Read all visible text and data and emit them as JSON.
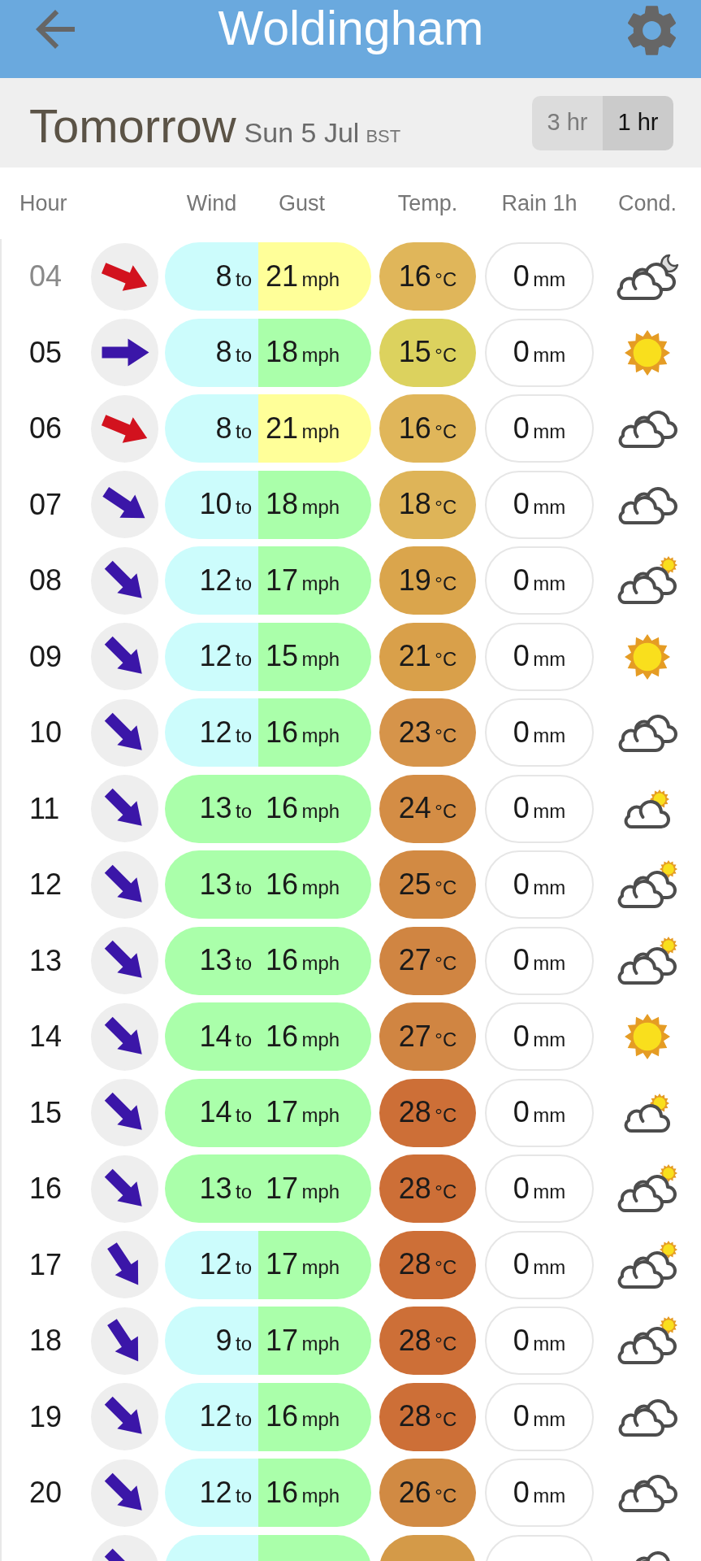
{
  "header": {
    "title": "Woldingham"
  },
  "day": {
    "title": "Tomorrow",
    "date": "Sun 5 Jul",
    "zone": "BST"
  },
  "interval": [
    {
      "label": "3 hr",
      "selected": false
    },
    {
      "label": "1 hr",
      "selected": true
    }
  ],
  "columns": [
    "Hour",
    "Wind",
    "Gust",
    "Temp.",
    "Rain 1h",
    "Cond."
  ],
  "rows": [
    {
      "hour": "04",
      "dimmed": true,
      "arrow": {
        "kind": "WNW",
        "color": "#d2121e"
      },
      "wind": {
        "speed": "8",
        "joiner": "to",
        "color": "#ccfcfc"
      },
      "gust": {
        "speed": "21",
        "unit": "mph",
        "color": "#ffff99"
      },
      "temp": {
        "value": "16",
        "unit": "°C",
        "color": "#e0b65a"
      },
      "rain": {
        "value": "0",
        "unit": "mm"
      },
      "condition": {
        "kind": "moon"
      }
    },
    {
      "hour": "05",
      "dimmed": false,
      "arrow": {
        "kind": "W",
        "color": "#3b16a8"
      },
      "wind": {
        "speed": "8",
        "joiner": "to",
        "color": "#ccfcfc"
      },
      "gust": {
        "speed": "18",
        "unit": "mph",
        "color": "#aaffaa"
      },
      "temp": {
        "value": "15",
        "unit": "°C",
        "color": "#dcd25e"
      },
      "rain": {
        "value": "0",
        "unit": "mm"
      },
      "condition": {
        "kind": "sun"
      }
    },
    {
      "hour": "06",
      "dimmed": false,
      "arrow": {
        "kind": "WNW",
        "color": "#d2121e"
      },
      "wind": {
        "speed": "8",
        "joiner": "to",
        "color": "#ccfcfc"
      },
      "gust": {
        "speed": "21",
        "unit": "mph",
        "color": "#ffff99"
      },
      "temp": {
        "value": "16",
        "unit": "°C",
        "color": "#e0b65a"
      },
      "rain": {
        "value": "0",
        "unit": "mm"
      },
      "condition": {
        "kind": "clouds"
      }
    },
    {
      "hour": "07",
      "dimmed": false,
      "arrow": {
        "kind": "NWbW",
        "color": "#3b16a8"
      },
      "wind": {
        "speed": "10",
        "joiner": "to",
        "color": "#ccfcfc"
      },
      "gust": {
        "speed": "18",
        "unit": "mph",
        "color": "#aaffaa"
      },
      "temp": {
        "value": "18",
        "unit": "°C",
        "color": "#deb458"
      },
      "rain": {
        "value": "0",
        "unit": "mm"
      },
      "condition": {
        "kind": "clouds"
      }
    },
    {
      "hour": "08",
      "dimmed": false,
      "arrow": {
        "kind": "NW",
        "color": "#3b16a8"
      },
      "wind": {
        "speed": "12",
        "joiner": "to",
        "color": "#ccfcfc"
      },
      "gust": {
        "speed": "17",
        "unit": "mph",
        "color": "#aaffaa"
      },
      "temp": {
        "value": "19",
        "unit": "°C",
        "color": "#daa54c"
      },
      "rain": {
        "value": "0",
        "unit": "mm"
      },
      "condition": {
        "kind": "sunclouds"
      }
    },
    {
      "hour": "09",
      "dimmed": false,
      "arrow": {
        "kind": "NW",
        "color": "#3b16a8"
      },
      "wind": {
        "speed": "12",
        "joiner": "to",
        "color": "#ccfcfc"
      },
      "gust": {
        "speed": "15",
        "unit": "mph",
        "color": "#aaffaa"
      },
      "temp": {
        "value": "21",
        "unit": "°C",
        "color": "#d9a04a"
      },
      "rain": {
        "value": "0",
        "unit": "mm"
      },
      "condition": {
        "kind": "sun"
      }
    },
    {
      "hour": "10",
      "dimmed": false,
      "arrow": {
        "kind": "NW",
        "color": "#3b16a8"
      },
      "wind": {
        "speed": "12",
        "joiner": "to",
        "color": "#ccfcfc"
      },
      "gust": {
        "speed": "16",
        "unit": "mph",
        "color": "#aaffaa"
      },
      "temp": {
        "value": "23",
        "unit": "°C",
        "color": "#d6944a"
      },
      "rain": {
        "value": "0",
        "unit": "mm"
      },
      "condition": {
        "kind": "clouds"
      }
    },
    {
      "hour": "11",
      "dimmed": false,
      "arrow": {
        "kind": "NW",
        "color": "#3b16a8"
      },
      "wind": {
        "speed": "13",
        "joiner": "to",
        "color": "#aaffaa"
      },
      "gust": {
        "speed": "16",
        "unit": "mph",
        "color": "#aaffaa"
      },
      "temp": {
        "value": "24",
        "unit": "°C",
        "color": "#d48d45"
      },
      "rain": {
        "value": "0",
        "unit": "mm"
      },
      "condition": {
        "kind": "suncloud"
      }
    },
    {
      "hour": "12",
      "dimmed": false,
      "arrow": {
        "kind": "NW",
        "color": "#3b16a8"
      },
      "wind": {
        "speed": "13",
        "joiner": "to",
        "color": "#aaffaa"
      },
      "gust": {
        "speed": "16",
        "unit": "mph",
        "color": "#aaffaa"
      },
      "temp": {
        "value": "25",
        "unit": "°C",
        "color": "#d28a43"
      },
      "rain": {
        "value": "0",
        "unit": "mm"
      },
      "condition": {
        "kind": "sunclouds"
      }
    },
    {
      "hour": "13",
      "dimmed": false,
      "arrow": {
        "kind": "NW",
        "color": "#3b16a8"
      },
      "wind": {
        "speed": "13",
        "joiner": "to",
        "color": "#aaffaa"
      },
      "gust": {
        "speed": "16",
        "unit": "mph",
        "color": "#aaffaa"
      },
      "temp": {
        "value": "27",
        "unit": "°C",
        "color": "#d08542"
      },
      "rain": {
        "value": "0",
        "unit": "mm"
      },
      "condition": {
        "kind": "sunclouds"
      }
    },
    {
      "hour": "14",
      "dimmed": false,
      "arrow": {
        "kind": "NW",
        "color": "#3b16a8"
      },
      "wind": {
        "speed": "14",
        "joiner": "to",
        "color": "#aaffaa"
      },
      "gust": {
        "speed": "16",
        "unit": "mph",
        "color": "#aaffaa"
      },
      "temp": {
        "value": "27",
        "unit": "°C",
        "color": "#d08542"
      },
      "rain": {
        "value": "0",
        "unit": "mm"
      },
      "condition": {
        "kind": "sun"
      }
    },
    {
      "hour": "15",
      "dimmed": false,
      "arrow": {
        "kind": "NW",
        "color": "#3b16a8"
      },
      "wind": {
        "speed": "14",
        "joiner": "to",
        "color": "#aaffaa"
      },
      "gust": {
        "speed": "17",
        "unit": "mph",
        "color": "#aaffaa"
      },
      "temp": {
        "value": "28",
        "unit": "°C",
        "color": "#cd6f37"
      },
      "rain": {
        "value": "0",
        "unit": "mm"
      },
      "condition": {
        "kind": "suncloud"
      }
    },
    {
      "hour": "16",
      "dimmed": false,
      "arrow": {
        "kind": "NW",
        "color": "#3b16a8"
      },
      "wind": {
        "speed": "13",
        "joiner": "to",
        "color": "#aaffaa"
      },
      "gust": {
        "speed": "17",
        "unit": "mph",
        "color": "#aaffaa"
      },
      "temp": {
        "value": "28",
        "unit": "°C",
        "color": "#cd6f37"
      },
      "rain": {
        "value": "0",
        "unit": "mm"
      },
      "condition": {
        "kind": "sunclouds"
      }
    },
    {
      "hour": "17",
      "dimmed": false,
      "arrow": {
        "kind": "NWbN",
        "color": "#3b16a8"
      },
      "wind": {
        "speed": "12",
        "joiner": "to",
        "color": "#ccfcfc"
      },
      "gust": {
        "speed": "17",
        "unit": "mph",
        "color": "#aaffaa"
      },
      "temp": {
        "value": "28",
        "unit": "°C",
        "color": "#cd6f37"
      },
      "rain": {
        "value": "0",
        "unit": "mm"
      },
      "condition": {
        "kind": "sunclouds"
      }
    },
    {
      "hour": "18",
      "dimmed": false,
      "arrow": {
        "kind": "NWbN",
        "color": "#3b16a8"
      },
      "wind": {
        "speed": "9",
        "joiner": "to",
        "color": "#ccfcfc"
      },
      "gust": {
        "speed": "17",
        "unit": "mph",
        "color": "#aaffaa"
      },
      "temp": {
        "value": "28",
        "unit": "°C",
        "color": "#cd6f37"
      },
      "rain": {
        "value": "0",
        "unit": "mm"
      },
      "condition": {
        "kind": "sunclouds"
      }
    },
    {
      "hour": "19",
      "dimmed": false,
      "arrow": {
        "kind": "NW",
        "color": "#3b16a8"
      },
      "wind": {
        "speed": "12",
        "joiner": "to",
        "color": "#ccfcfc"
      },
      "gust": {
        "speed": "16",
        "unit": "mph",
        "color": "#aaffaa"
      },
      "temp": {
        "value": "28",
        "unit": "°C",
        "color": "#cd6f37"
      },
      "rain": {
        "value": "0",
        "unit": "mm"
      },
      "condition": {
        "kind": "clouds"
      }
    },
    {
      "hour": "20",
      "dimmed": false,
      "arrow": {
        "kind": "NW",
        "color": "#3b16a8"
      },
      "wind": {
        "speed": "12",
        "joiner": "to",
        "color": "#ccfcfc"
      },
      "gust": {
        "speed": "16",
        "unit": "mph",
        "color": "#aaffaa"
      },
      "temp": {
        "value": "26",
        "unit": "°C",
        "color": "#d18a43"
      },
      "rain": {
        "value": "0",
        "unit": "mm"
      },
      "condition": {
        "kind": "clouds"
      }
    },
    {
      "arrow": {
        "kind": "NW",
        "color": "#3b16a8"
      },
      "wind": {
        "color": "#ccfcfc"
      },
      "gust": {
        "color": "#aaffaa"
      },
      "temp": {
        "color": "#d49a48"
      },
      "condition": {
        "kind": "clouds"
      }
    }
  ]
}
